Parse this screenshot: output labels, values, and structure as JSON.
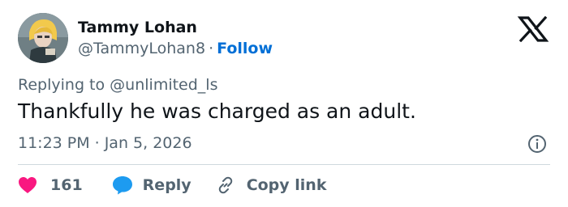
{
  "author": {
    "name": "Tammy Lohan",
    "handle": "@TammyLohan8",
    "separator": "·",
    "follow_label": "Follow"
  },
  "reply_context": {
    "prefix": "Replying to",
    "mention": "@unlimited_ls"
  },
  "tweet": {
    "text": "Thankfully he was charged as an adult.",
    "time": "11:23 PM",
    "separator": "·",
    "date": "Jan 5, 2026"
  },
  "actions": {
    "like_count": "161",
    "reply_label": "Reply",
    "copy_link_label": "Copy link"
  },
  "icons": {
    "brand": "x-logo-icon",
    "info": "info-icon",
    "like": "heart-icon",
    "reply": "speech-bubble-icon",
    "copy": "link-icon"
  },
  "colors": {
    "text_primary": "#0f1419",
    "text_secondary": "#536471",
    "follow_blue": "#006fd6",
    "like_pink": "#f91880",
    "reply_blue": "#1d9bf0",
    "divider": "#cfd9de"
  }
}
